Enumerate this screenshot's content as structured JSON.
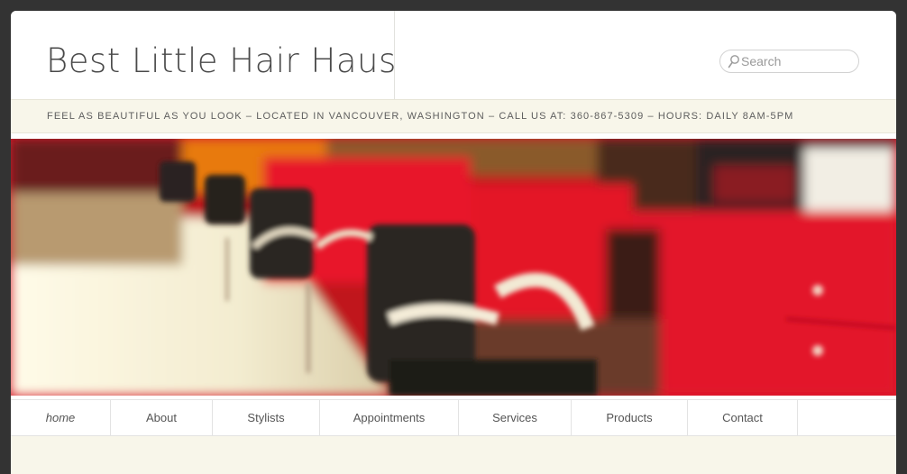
{
  "header": {
    "site_title": "Best Little Hair Haus"
  },
  "search": {
    "placeholder": "Search"
  },
  "tagline": {
    "text": "FEEL AS BEAUTIFUL AS YOU LOOK – LOCATED IN VANCOUVER, WASHINGTON – CALL US AT: 360-867-5309 – HOURS: DAILY 8AM-5PM"
  },
  "hero": {
    "image": "blurred salon interior with black styling chairs and red cabinets"
  },
  "nav": {
    "items": [
      {
        "label": "home",
        "active": true
      },
      {
        "label": "About"
      },
      {
        "label": "Stylists"
      },
      {
        "label": "Appointments"
      },
      {
        "label": "Services"
      },
      {
        "label": "Products"
      },
      {
        "label": "Contact"
      }
    ]
  },
  "colors": {
    "page_background": "#333333",
    "tagline_background": "#f8f6ea",
    "hero_red": "#d41a2a"
  },
  "icons": {
    "search": "search-icon"
  }
}
